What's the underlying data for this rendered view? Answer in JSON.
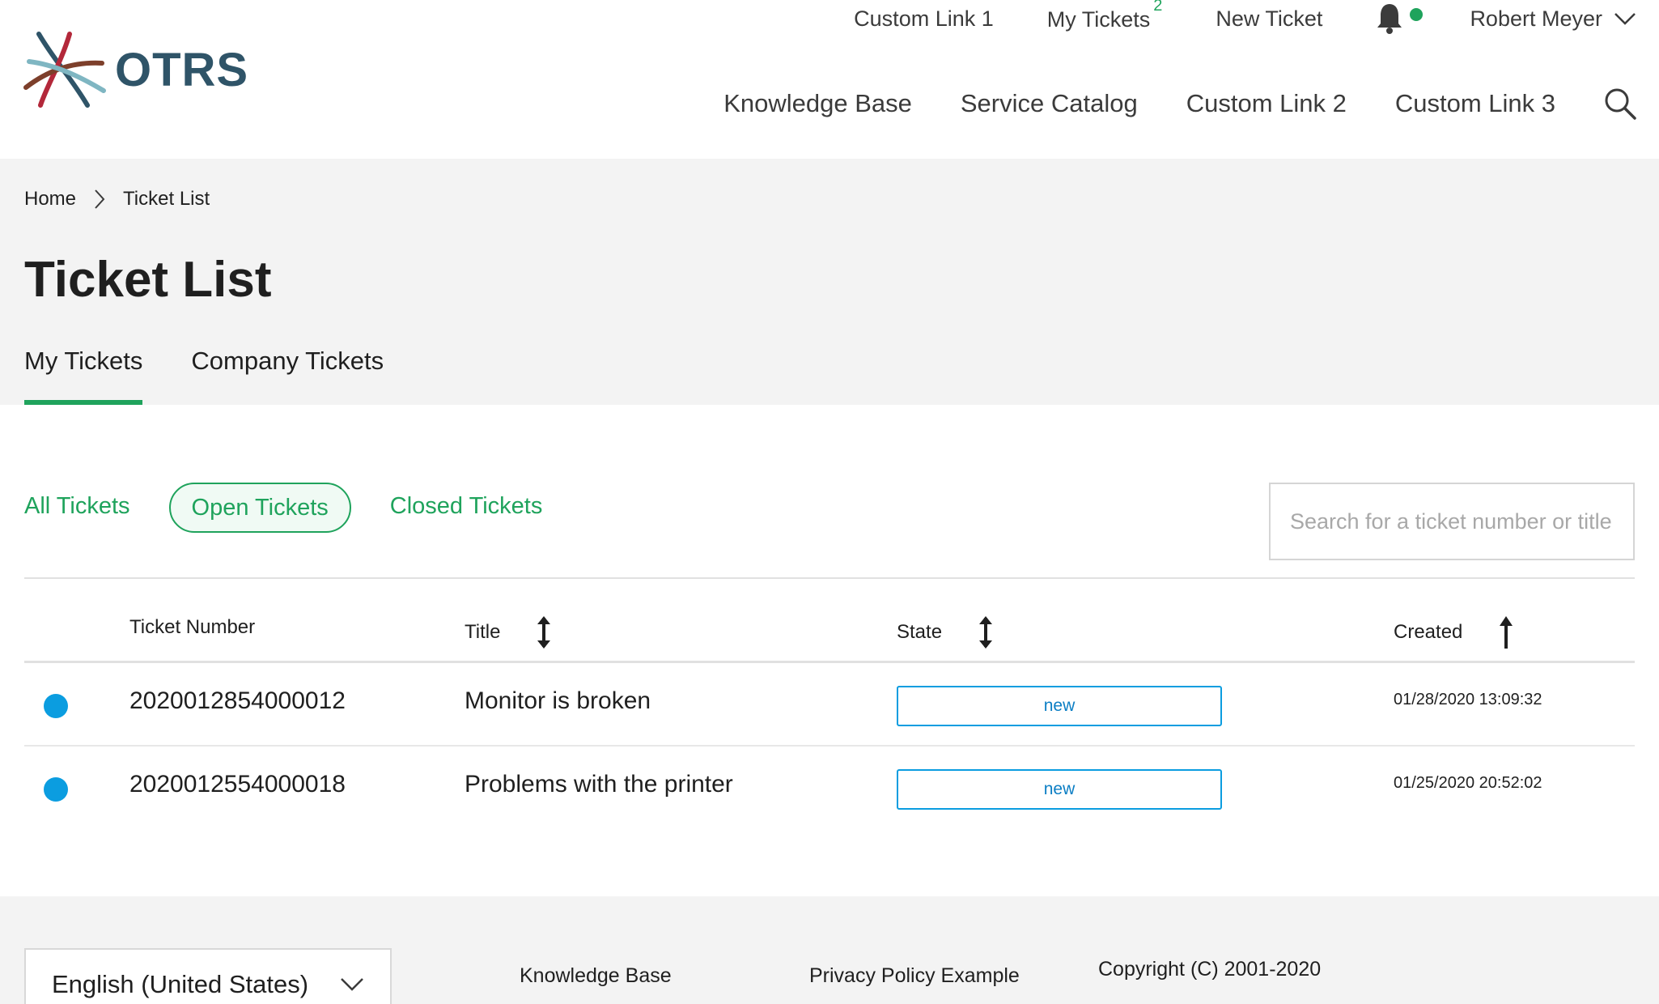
{
  "brand": {
    "logo_text": "OTRS",
    "accent": "#1fa35c",
    "info_blue": "#0b9de0"
  },
  "top_nav": {
    "custom_link_1": "Custom Link 1",
    "my_tickets": "My Tickets",
    "my_tickets_count": "2",
    "new_ticket": "New Ticket",
    "user_name": "Robert Meyer"
  },
  "main_nav": {
    "items": [
      "Knowledge Base",
      "Service Catalog",
      "Custom Link 2",
      "Custom Link 3"
    ]
  },
  "breadcrumb": {
    "home": "Home",
    "current": "Ticket List"
  },
  "page_title": "Ticket List",
  "tabs": [
    "My Tickets",
    "Company Tickets"
  ],
  "filters": [
    "All Tickets",
    "Open Tickets",
    "Closed Tickets"
  ],
  "search": {
    "placeholder": "Search for a ticket number or title"
  },
  "table": {
    "headers": {
      "number": "Ticket Number",
      "title": "Title",
      "state": "State",
      "created": "Created"
    },
    "rows": [
      {
        "number": "2020012854000012",
        "title": "Monitor is broken",
        "state": "new",
        "created": "01/28/2020 13:09:32"
      },
      {
        "number": "2020012554000018",
        "title": "Problems with the printer",
        "state": "new",
        "created": "01/25/2020 20:52:02"
      }
    ]
  },
  "footer": {
    "language": "English (United States)",
    "links": [
      "Knowledge Base",
      "Privacy Policy Example"
    ],
    "copyright": "Copyright (C) 2001-2020"
  }
}
